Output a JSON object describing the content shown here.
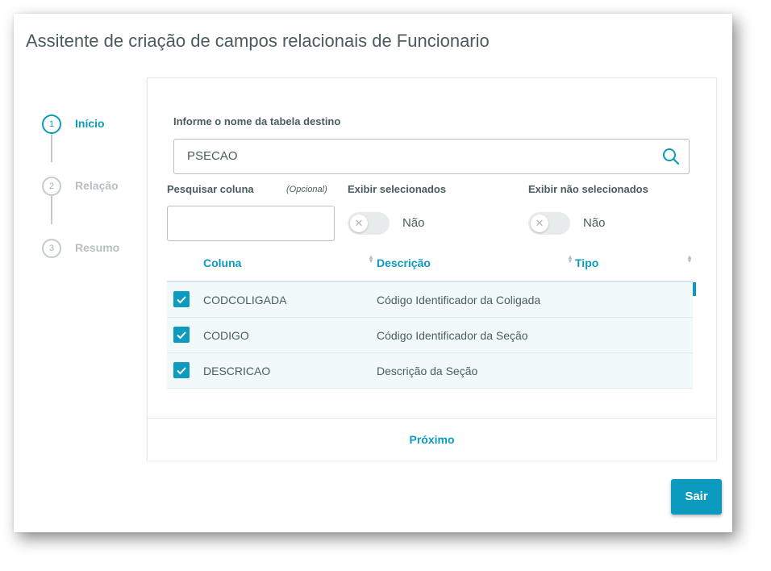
{
  "dialog": {
    "title": "Assitente de criação de campos relacionais de Funcionario"
  },
  "stepper": {
    "steps": [
      {
        "number": "1",
        "label": "Início",
        "active": true
      },
      {
        "number": "2",
        "label": "Relação",
        "active": false
      },
      {
        "number": "3",
        "label": "Resumo",
        "active": false
      }
    ]
  },
  "form": {
    "table_label": "Informe o nome da tabela destino",
    "table_value": "PSECAO",
    "column_search_label": "Pesquisar coluna",
    "column_search_optional": "(Opcional)",
    "column_search_value": "",
    "show_selected_label": "Exibir selecionados",
    "show_selected_value": "Não",
    "show_unselected_label": "Exibir não selecionados",
    "show_unselected_value": "Não"
  },
  "table": {
    "headers": [
      "Coluna",
      "Descrição",
      "Tipo"
    ],
    "rows": [
      {
        "coluna": "CODCOLIGADA",
        "descricao": "Código Identificador da Coligada",
        "tipo": "",
        "checked": true
      },
      {
        "coluna": "CODIGO",
        "descricao": "Código Identificador da Seção",
        "tipo": "",
        "checked": true
      },
      {
        "coluna": "DESCRICAO",
        "descricao": "Descrição da Seção",
        "tipo": "",
        "checked": true
      }
    ]
  },
  "footer": {
    "next_label": "Próximo"
  },
  "actions": {
    "exit_label": "Sair"
  },
  "colors": {
    "accent": "#0c9abe",
    "text": "#4a5c60",
    "row_bg": "#f2f9fb"
  }
}
